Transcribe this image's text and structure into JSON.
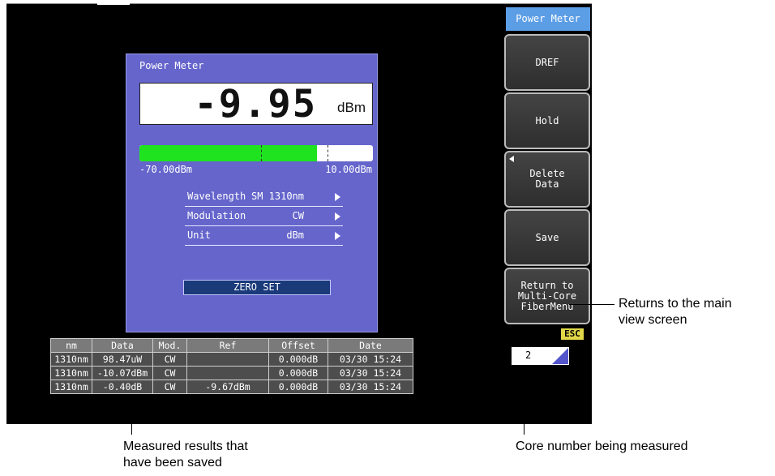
{
  "panel": {
    "title": "Power Meter",
    "reading": "-9.95",
    "reading_unit": "dBm",
    "bar": {
      "min_label": "-70.00dBm",
      "max_label": "10.00dBm",
      "level_fraction": 0.76
    },
    "settings": [
      {
        "label": "Wavelength",
        "value": "SM 1310nm"
      },
      {
        "label": "Modulation",
        "value": "CW"
      },
      {
        "label": "Unit",
        "value": "dBm"
      }
    ],
    "zero_set_label": "ZERO SET"
  },
  "results_table": {
    "headers": [
      "nm",
      "Data",
      "Mod.",
      "Ref",
      "Offset",
      "Date"
    ],
    "rows": [
      [
        "1310nm",
        "98.47uW",
        "CW",
        "",
        "0.000dB",
        "03/30 15:24"
      ],
      [
        "1310nm",
        "-10.07dBm",
        "CW",
        "",
        "0.000dB",
        "03/30 15:24"
      ],
      [
        "1310nm",
        "-0.40dB",
        "CW",
        "-9.67dBm",
        "0.000dB",
        "03/30 15:24"
      ]
    ]
  },
  "softkeys": {
    "header": "Power Meter",
    "dref": "DREF",
    "hold": "Hold",
    "delete_data": "Delete\nData",
    "save": "Save",
    "return": "Return to\nMulti-Core\nFiberMenu"
  },
  "esc_label": "ESC",
  "core_number": "2",
  "annotations": {
    "return_note": "Returns to the main\nview screen",
    "saved_note": "Measured results that\nhave been saved",
    "core_note": "Core number being measured"
  },
  "colors": {
    "bar_fill": "#1fe31f",
    "panel_bg": "#6565cc",
    "header_bg": "#5c9ee6"
  }
}
